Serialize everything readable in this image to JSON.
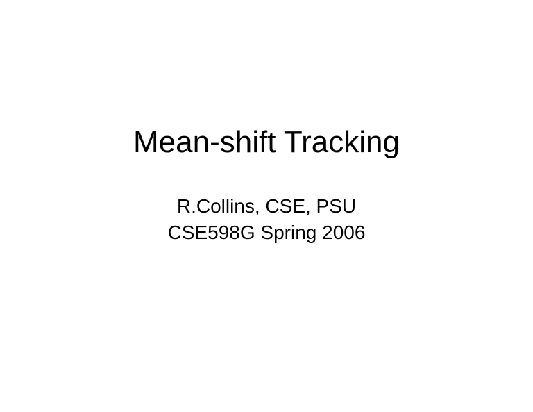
{
  "slide": {
    "title": "Mean-shift Tracking",
    "author_line": "R.Collins, CSE, PSU",
    "course_line": "CSE598G Spring 2006"
  }
}
